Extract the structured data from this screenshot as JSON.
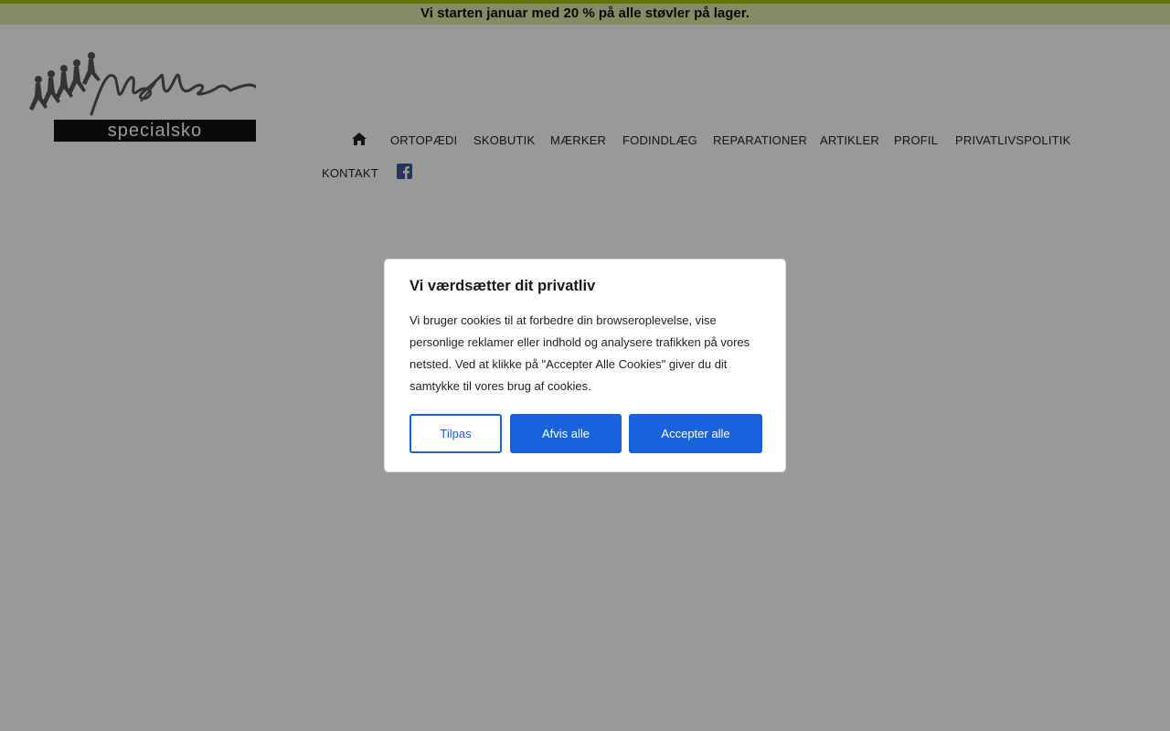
{
  "announcement": "Vi starten januar med 20 % på alle støvler på lager.",
  "logo": {
    "script_text": "Møller",
    "sub_text": "specialsko"
  },
  "nav": {
    "home_icon": "home-icon",
    "items": [
      {
        "label": "ORTOPÆDI"
      },
      {
        "label": "SKOBUTIK"
      },
      {
        "label": "MÆRKER"
      },
      {
        "label": "FODINDLÆG"
      },
      {
        "label": "REPARATIONER"
      },
      {
        "label": "ARTIKLER"
      },
      {
        "label": "PROFIL"
      },
      {
        "label": "PRIVATLIVSPOLITIK"
      },
      {
        "label": "KONTAKT"
      }
    ],
    "facebook_icon": "facebook-icon"
  },
  "cookie_banner": {
    "title": "Vi værdsætter dit privatliv",
    "text": "Vi bruger cookies til at forbedre din browseroplevelse, vise personlige reklamer eller indhold og analysere trafikken på vores netsted. Ved at klikke på \"Accepter Alle Cookies\" giver du dit samtykke til vores brug af cookies.",
    "customize_label": "Tilpas",
    "reject_label": "Afvis alle",
    "accept_label": "Accepter alle"
  },
  "colors": {
    "accent_bar": "#a4c400",
    "announcement_bg": "#dfe8a8",
    "button_blue": "#1863dc",
    "facebook_blue": "#3b5998"
  }
}
